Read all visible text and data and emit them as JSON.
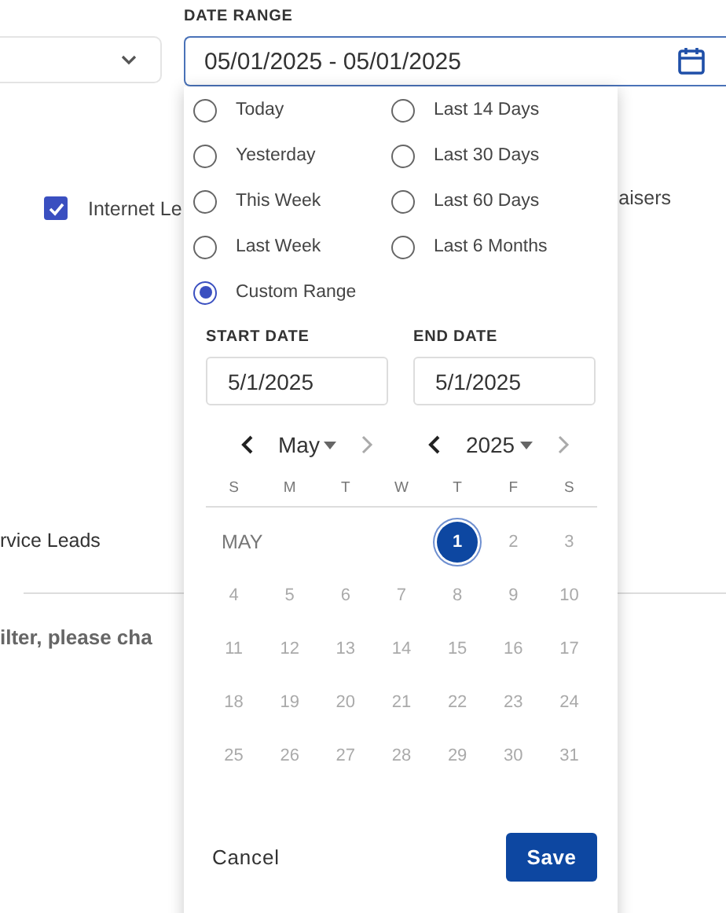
{
  "filters": {
    "checkbox": {
      "label": "Internet Le",
      "checked": true
    },
    "right_text": "aisers",
    "service_text": "rvice Leads",
    "hint_text": "ilter, please cha"
  },
  "date_range": {
    "label": "DATE RANGE",
    "value": "05/01/2025 - 05/01/2025"
  },
  "popup": {
    "presets": [
      {
        "label": "Today",
        "selected": false
      },
      {
        "label": "Last 14 Days",
        "selected": false
      },
      {
        "label": "Yesterday",
        "selected": false
      },
      {
        "label": "Last 30 Days",
        "selected": false
      },
      {
        "label": "This Week",
        "selected": false
      },
      {
        "label": "Last 60 Days",
        "selected": false
      },
      {
        "label": "Last Week",
        "selected": false
      },
      {
        "label": "Last 6 Months",
        "selected": false
      },
      {
        "label": "Custom Range",
        "selected": true
      }
    ],
    "start_date": {
      "label": "START DATE",
      "value": "5/1/2025"
    },
    "end_date": {
      "label": "END DATE",
      "value": "5/1/2025"
    },
    "month": "May",
    "year": "2025",
    "weekdays": [
      "S",
      "M",
      "T",
      "W",
      "T",
      "F",
      "S"
    ],
    "month_label": "MAY",
    "days": [
      {
        "label": "1",
        "selected": true
      },
      {
        "label": "2",
        "selected": false
      },
      {
        "label": "3",
        "selected": false
      },
      {
        "label": "4",
        "selected": false
      },
      {
        "label": "5",
        "selected": false
      },
      {
        "label": "6",
        "selected": false
      },
      {
        "label": "7",
        "selected": false
      },
      {
        "label": "8",
        "selected": false
      },
      {
        "label": "9",
        "selected": false
      },
      {
        "label": "10",
        "selected": false
      },
      {
        "label": "11",
        "selected": false
      },
      {
        "label": "12",
        "selected": false
      },
      {
        "label": "13",
        "selected": false
      },
      {
        "label": "14",
        "selected": false
      },
      {
        "label": "15",
        "selected": false
      },
      {
        "label": "16",
        "selected": false
      },
      {
        "label": "17",
        "selected": false
      },
      {
        "label": "18",
        "selected": false
      },
      {
        "label": "19",
        "selected": false
      },
      {
        "label": "20",
        "selected": false
      },
      {
        "label": "21",
        "selected": false
      },
      {
        "label": "22",
        "selected": false
      },
      {
        "label": "23",
        "selected": false
      },
      {
        "label": "24",
        "selected": false
      },
      {
        "label": "25",
        "selected": false
      },
      {
        "label": "26",
        "selected": false
      },
      {
        "label": "27",
        "selected": false
      },
      {
        "label": "28",
        "selected": false
      },
      {
        "label": "29",
        "selected": false
      },
      {
        "label": "30",
        "selected": false
      },
      {
        "label": "31",
        "selected": false
      }
    ],
    "cancel": "Cancel",
    "save": "Save"
  }
}
